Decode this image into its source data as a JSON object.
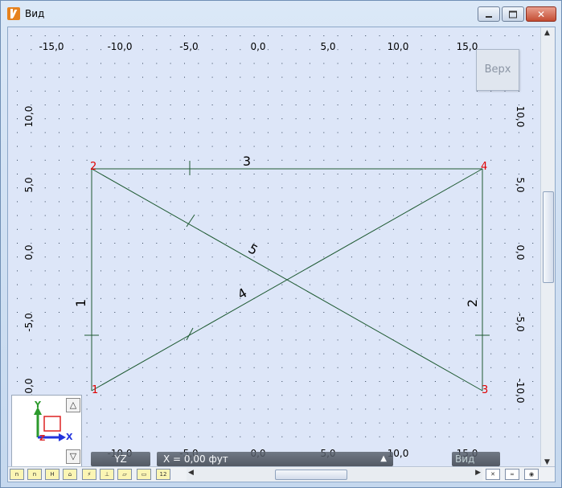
{
  "window": {
    "title": "Вид",
    "minimize_label": "",
    "maximize_label": "",
    "close_label": ""
  },
  "view": {
    "orientation_button": "Верх",
    "x_ticks": [
      "-15,0",
      "-10,0",
      "-5,0",
      "0,0",
      "5,0",
      "10,0",
      "15,0"
    ],
    "y_ticks": [
      "10,0",
      "5,0",
      "0,0",
      "-5,0",
      "-10,0"
    ],
    "nodes": [
      "1",
      "2",
      "3",
      "4"
    ],
    "members": [
      "1",
      "2",
      "3",
      "4",
      "5"
    ]
  },
  "status": {
    "plane": "YZ",
    "coordinate": "X = 0,00 фут",
    "view_label": "Вид"
  },
  "axes_widget": {
    "y_label": "Y",
    "x_label": "X",
    "z_label": "Z"
  },
  "colors": {
    "background": "#dde6f8",
    "member": "#1e5a32",
    "node": "#e00000",
    "grid": "#33445a"
  }
}
